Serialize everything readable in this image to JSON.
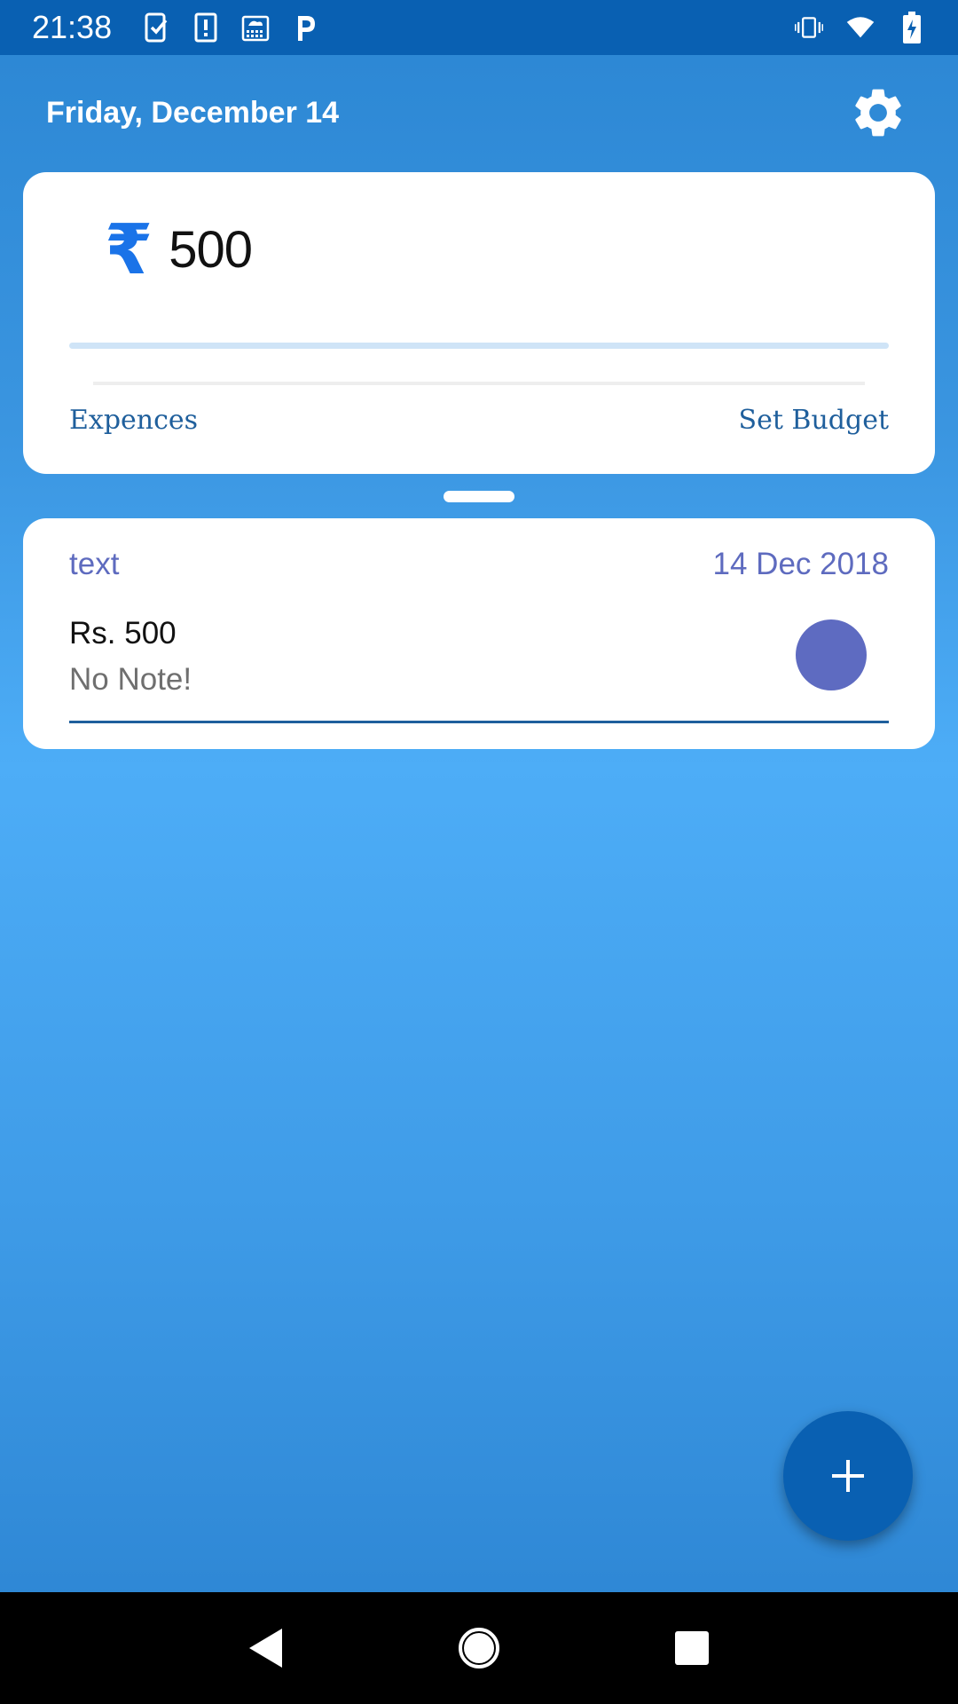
{
  "status_bar": {
    "time": "21:38",
    "left_icons": [
      "task-check-icon",
      "alert-icon",
      "cloud-calendar-icon",
      "parking-icon"
    ],
    "right_icons": [
      "vibrate-icon",
      "wifi-icon",
      "battery-charging-icon"
    ]
  },
  "header": {
    "date": "Friday, December 14",
    "settings_icon": "gear-icon"
  },
  "budget_card": {
    "currency_symbol": "₹",
    "amount": "500",
    "progress": 1.0,
    "expences_label": "Expences",
    "set_budget_label": "Set Budget"
  },
  "expenses": [
    {
      "category": "text",
      "date": "14 Dec 2018",
      "amount": "Rs. 500",
      "note": "No Note!",
      "color": "#5e6bc1"
    }
  ],
  "fab": {
    "icon": "plus-icon"
  },
  "navbar": {
    "icons": [
      "back-icon",
      "home-icon",
      "recents-icon"
    ]
  },
  "colors": {
    "primary_dark": "#0960b2",
    "accent_blue": "#1a73e8",
    "indigo": "#5e6bc1"
  }
}
